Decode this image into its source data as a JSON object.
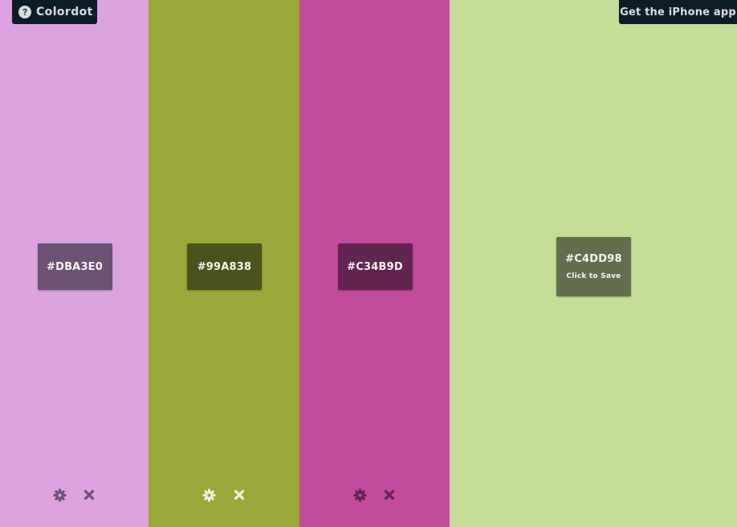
{
  "brand": {
    "label": "Colordot",
    "icon": "question-circle-icon"
  },
  "iphone_app": {
    "label": "Get the iPhone app"
  },
  "strips": [
    {
      "hex": "#DBA3E0",
      "color": "#dba3e0",
      "box_color": "#6c5273",
      "control_color": "#6c5273",
      "has_controls": true
    },
    {
      "hex": "#99A838",
      "color": "#99a838",
      "box_color": "#4b531c",
      "control_color": "#eef0d8",
      "has_controls": true
    },
    {
      "hex": "#C34B9D",
      "color": "#c34b9d",
      "box_color": "#62254f",
      "control_color": "#62254f",
      "has_controls": true
    },
    {
      "hex": "#C4DD98",
      "color": "#c4dd98",
      "box_color": "#636e4d",
      "save_label": "Click to Save",
      "has_controls": false
    }
  ],
  "icons": {
    "settings": "gear-icon",
    "remove": "close-icon"
  }
}
